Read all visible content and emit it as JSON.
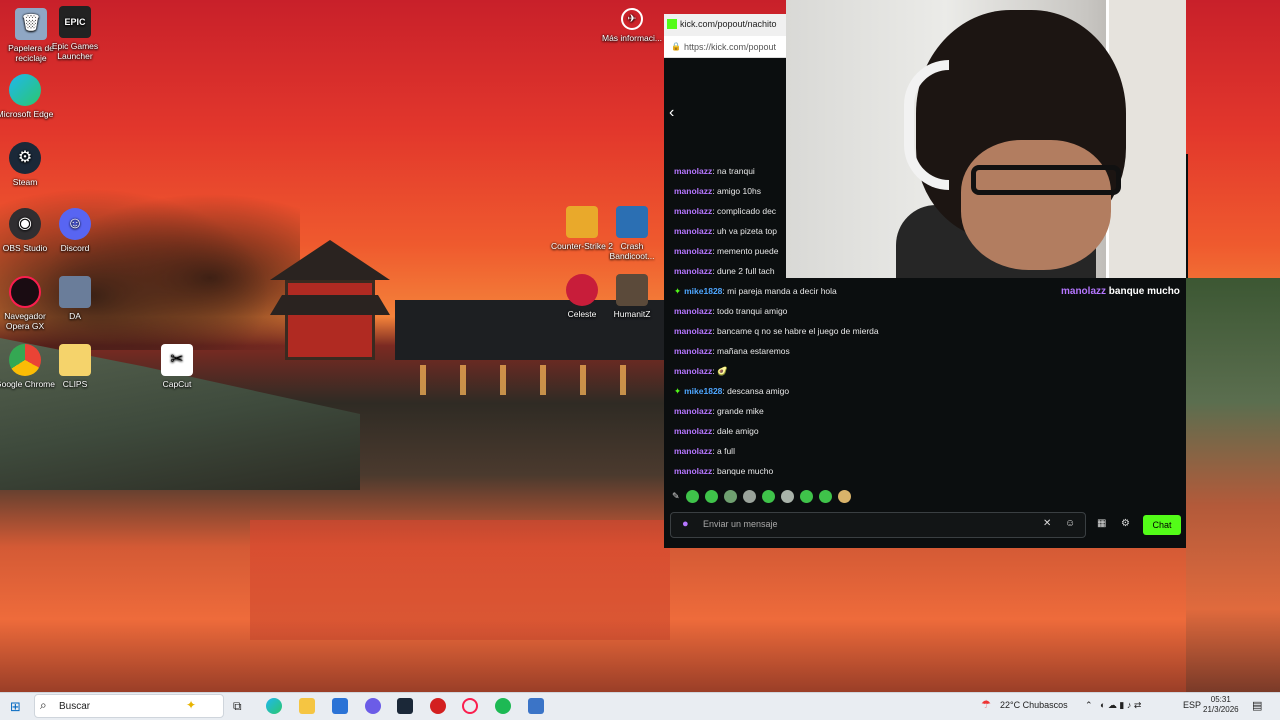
{
  "desktop": {
    "icons": [
      {
        "label": "Papelera de reciclaje",
        "icon": "recycle-bin-icon"
      },
      {
        "label": "Epic Games Launcher",
        "icon": "epic-games-icon",
        "glyph": "EPIC"
      },
      {
        "label": "Microsoft Edge",
        "icon": "edge-icon"
      },
      {
        "label": "Steam",
        "icon": "steam-icon"
      },
      {
        "label": "OBS Studio",
        "icon": "obs-icon"
      },
      {
        "label": "Discord",
        "icon": "discord-icon"
      },
      {
        "label": "Navegador Opera GX",
        "icon": "opera-gx-icon"
      },
      {
        "label": "DA",
        "icon": "da-icon"
      },
      {
        "label": "Google Chrome",
        "icon": "chrome-icon"
      },
      {
        "label": "CLIPS",
        "icon": "folder-icon"
      },
      {
        "label": "CapCut",
        "icon": "capcut-icon"
      },
      {
        "label": "Counter-Strike 2",
        "icon": "counter-strike-icon"
      },
      {
        "label": "Crash Bandicoot...",
        "icon": "crash-bandicoot-icon"
      },
      {
        "label": "Celeste",
        "icon": "celeste-icon"
      },
      {
        "label": "HumanitZ",
        "icon": "humanitz-icon"
      },
      {
        "label": "Más informaci...",
        "icon": "info-icon"
      }
    ]
  },
  "browser": {
    "title": "kick.com/popout/nachito",
    "url": "https://kick.com/popout"
  },
  "chat": {
    "messages": [
      {
        "user": "manolazz",
        "text": "na tranqui"
      },
      {
        "user": "manolazz",
        "text": "amigo 10hs"
      },
      {
        "user": "manolazz",
        "text": "complicado dec"
      },
      {
        "user": "manolazz",
        "text": "uh va pizeta top"
      },
      {
        "user": "manolazz",
        "text": "memento puede"
      },
      {
        "user": "manolazz",
        "text": "dune 2 full tach"
      },
      {
        "user": "mike1828",
        "text": "mi pareja manda a decir hola",
        "badge": true
      },
      {
        "user": "manolazz",
        "text": "todo tranqui amigo"
      },
      {
        "user": "manolazz",
        "text": "bancame q no se habre el juego de mierda"
      },
      {
        "user": "manolazz",
        "text": "mañana estaremos"
      },
      {
        "user": "manolazz",
        "text": "🥑"
      },
      {
        "user": "mike1828",
        "text": "descansa amigo",
        "badge": true
      },
      {
        "user": "manolazz",
        "text": "grande mike"
      },
      {
        "user": "manolazz",
        "text": "dale amigo"
      },
      {
        "user": "manolazz",
        "text": "a full"
      },
      {
        "user": "manolazz",
        "text": "banque mucho"
      }
    ],
    "input_placeholder": "Enviar un mensaje",
    "send_label": "Chat"
  },
  "overlay": {
    "user": "manolazz",
    "text": "banque mucho"
  },
  "taskbar": {
    "search_label": "Buscar",
    "weather": "22°C  Chubascos",
    "lang": "ESP",
    "time": "05:31",
    "date": "21/3/2026"
  },
  "colors": {
    "kick_green": "#53fc18",
    "username_purple": "#b576ff",
    "username_blue": "#4ea6ff"
  }
}
